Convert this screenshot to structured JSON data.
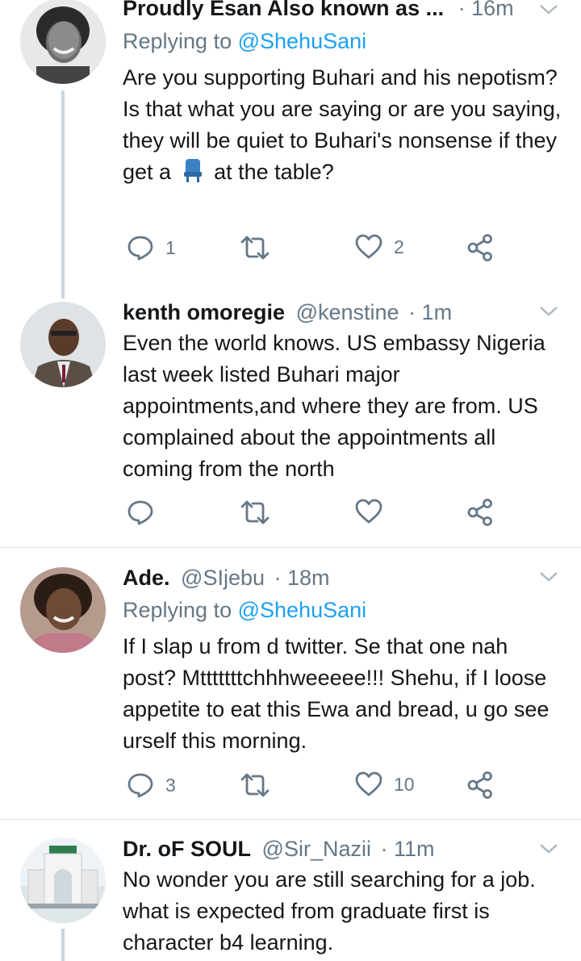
{
  "tweets": [
    {
      "name": "Proudly Esan Also known as ...",
      "handle": "",
      "time": "· 16m",
      "replying_prefix": "Replying to",
      "replying_to": "@ShehuSani",
      "text_before_emoji": "Are you supporting Buhari and his nepotism? Is that what you are saying or are you saying, they will be quiet to Buhari's nonsense if they get a",
      "emoji": "seat",
      "text_after_emoji": "at the table?",
      "replies": "1",
      "retweets": "",
      "likes": "2"
    },
    {
      "name": "kenth omoregie",
      "handle": "@kenstine",
      "time": "· 1m",
      "text": "Even the world knows. US embassy Nigeria last week listed Buhari major appointments,and where they are from. US complained about the appointments all coming from the north",
      "replies": "",
      "retweets": "",
      "likes": ""
    },
    {
      "name": "Ade.",
      "handle": "@SIjebu",
      "time": "· 18m",
      "replying_prefix": "Replying to",
      "replying_to": "@ShehuSani",
      "text": "If I slap u from d twitter. Se that one nah post? Mtttttttchhhweeeee!!! Shehu, if I loose appetite to eat this Ewa and bread, u go see urself this morning.",
      "replies": "3",
      "retweets": "",
      "likes": "10"
    },
    {
      "name": "Dr. oF SOUL",
      "handle": "@Sir_Nazii",
      "time": "· 11m",
      "text": "No wonder you are still searching for a job. what is expected from graduate first is character b4 learning."
    }
  ],
  "icons": {
    "reply": "reply-icon",
    "retweet": "retweet-icon",
    "like": "heart-icon",
    "share": "share-icon",
    "more": "chevron-down-icon"
  },
  "colors": {
    "text": "#14171a",
    "secondary": "#657786",
    "link": "#1da1f2",
    "divider": "#e1e8ed",
    "thread_line": "#ccd6dd"
  }
}
